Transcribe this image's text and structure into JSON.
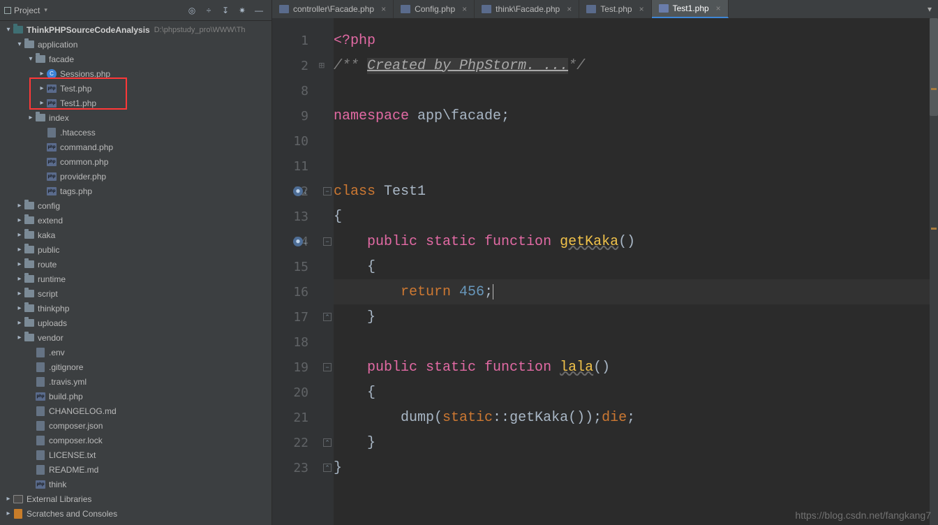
{
  "header": {
    "title": "Project",
    "icons": [
      "target",
      "tree",
      "collapse",
      "settings",
      "minimize"
    ]
  },
  "project": {
    "root": {
      "name": "ThinkPHPSourceCodeAnalysis",
      "path": "D:\\phpstudy_pro\\WWW\\Th"
    },
    "application": "application",
    "facade": "facade",
    "sessions": "Sessions.php",
    "test": "Test.php",
    "test1": "Test1.php",
    "index": "index",
    "htaccess": ".htaccess",
    "command": "command.php",
    "common": "common.php",
    "provider": "provider.php",
    "tags": "tags.php",
    "config": "config",
    "extend": "extend",
    "kaka": "kaka",
    "public": "public",
    "route": "route",
    "runtime": "runtime",
    "script": "script",
    "thinkphp": "thinkphp",
    "uploads": "uploads",
    "vendor": "vendor",
    "env": ".env",
    "gitignore": ".gitignore",
    "travis": ".travis.yml",
    "build": "build.php",
    "changelog": "CHANGELOG.md",
    "composerjson": "composer.json",
    "composerlock": "composer.lock",
    "license": "LICENSE.txt",
    "readme": "README.md",
    "think": "think",
    "external": "External Libraries",
    "scratches": "Scratches and Consoles"
  },
  "tabs": [
    {
      "name": "controller\\Facade.php",
      "active": false
    },
    {
      "name": "Config.php",
      "active": false
    },
    {
      "name": "think\\Facade.php",
      "active": false
    },
    {
      "name": "Test.php",
      "active": false
    },
    {
      "name": "Test1.php",
      "active": true
    }
  ],
  "code": {
    "lines": [
      "1",
      "2",
      "8",
      "9",
      "10",
      "11",
      "12",
      "13",
      "14",
      "15",
      "16",
      "17",
      "18",
      "19",
      "20",
      "21",
      "22",
      "23"
    ],
    "l1_open": "<?php",
    "l2_cmt_pre": "/**",
    "l2_cmt_body": "Created by PhpStorm. ...",
    "l2_cmt_post": "*/",
    "l9_a": "namespace",
    "l9_b": " app\\facade",
    "l9_c": ";",
    "l12_a": "class",
    "l12_b": " Test1",
    "l13": "{",
    "l14_a": "public",
    "l14_b": " static",
    "l14_c": " function",
    "l14_d": " ",
    "l14_fn": "getKaka",
    "l14_e": "()",
    "l15": "{",
    "l16_a": "return",
    "l16_b": " ",
    "l16_num": "456",
    "l16_c": ";",
    "l17": "}",
    "l19_a": "public",
    "l19_b": " static",
    "l19_c": " function",
    "l19_d": " ",
    "l19_fn": "lala",
    "l19_e": "()",
    "l20": "{",
    "l21_a": "dump(",
    "l21_b": "static",
    "l21_c": "::",
    "l21_d": "getKaka",
    "l21_e": "());",
    "l21_f": "die",
    "l21_g": ";",
    "l22": "}",
    "l23": "}"
  },
  "watermark": "https://blog.csdn.net/fangkang7"
}
